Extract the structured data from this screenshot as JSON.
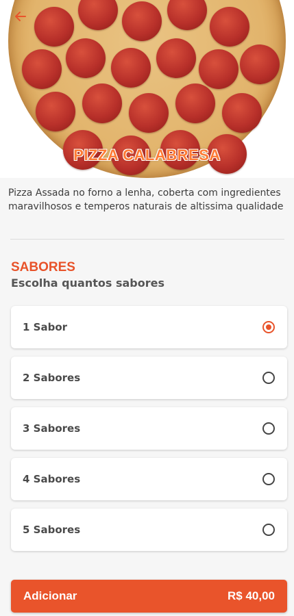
{
  "product": {
    "title": "PIZZA CALABRESA",
    "description": "Pizza Assada no forno a lenha, coberta com ingredientes maravilhosos e temperos naturais de altissima qualidade"
  },
  "header": {
    "back_icon": "arrow-left-icon"
  },
  "section": {
    "title": "SABORES",
    "subtitle": "Escolha quantos sabores"
  },
  "options": [
    {
      "label": "1 Sabor",
      "selected": true
    },
    {
      "label": "2 Sabores",
      "selected": false
    },
    {
      "label": "3 Sabores",
      "selected": false
    },
    {
      "label": "4 Sabores",
      "selected": false
    },
    {
      "label": "5 Sabores",
      "selected": false
    }
  ],
  "footer": {
    "add_label": "Adicionar",
    "price": "R$ 40,00"
  },
  "colors": {
    "accent": "#e9542b",
    "title_orange": "#ff7b35"
  }
}
